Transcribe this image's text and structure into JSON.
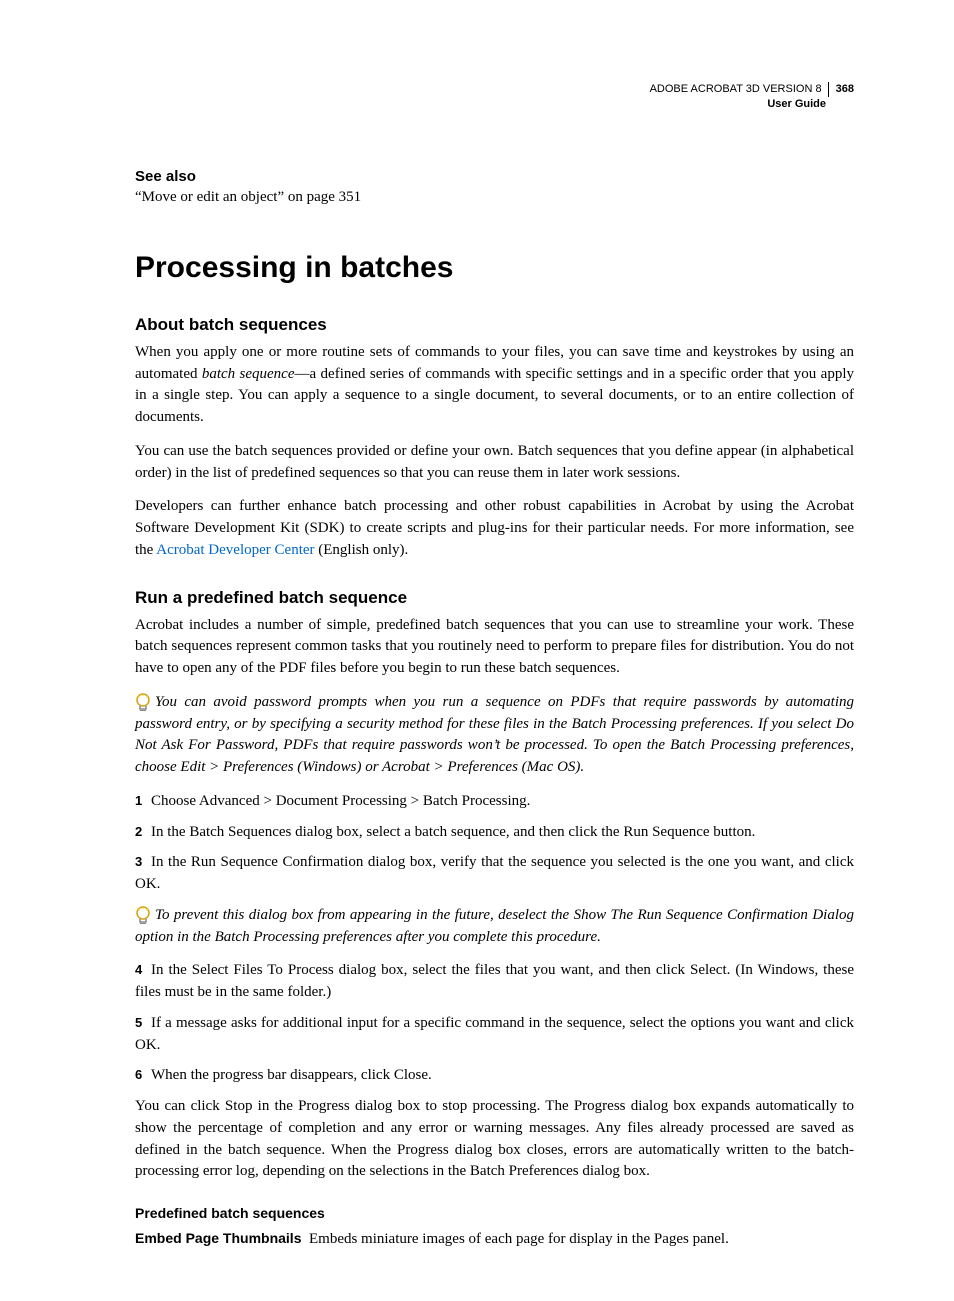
{
  "header": {
    "product": "ADOBE ACROBAT 3D VERSION 8",
    "doc": "User Guide",
    "page": "368"
  },
  "see_also": {
    "heading": "See also",
    "text": "“Move or edit an object” on page 351"
  },
  "h1": "Processing in batches",
  "section1": {
    "heading": "About batch sequences",
    "p1a": "When you apply one or more routine sets of commands to your files, you can save time and keystrokes by using an automated ",
    "p1b": "batch sequence",
    "p1c": "—a defined series of commands with specific settings and in a specific order that you apply in a single step. You can apply a sequence to a single document, to several documents, or to an entire collection of documents.",
    "p2": "You can use the batch sequences provided or define your own. Batch sequences that you define appear (in alphabetical order) in the list of predefined sequences so that you can reuse them in later work sessions.",
    "p3a": "Developers can further enhance batch processing and other robust capabilities in Acrobat by using the Acrobat Software Development Kit (SDK) to create scripts and plug-ins for their particular needs. For more information, see the ",
    "p3_link": "Acrobat Developer Center",
    "p3b": " (English only)."
  },
  "section2": {
    "heading": "Run a predefined batch sequence",
    "p1": "Acrobat includes a number of simple, predefined batch sequences that you can use to streamline your work. These batch sequences represent common tasks that you routinely need to perform to prepare files for distribution. You do not have to open any of the PDF files before you begin to run these batch sequences.",
    "tip1": "You can avoid password prompts when you run a sequence on PDFs that require passwords by automating password entry, or by specifying a security method for these files in the Batch Processing preferences. If you select Do Not Ask For Password, PDFs that require passwords won’t be processed. To open the Batch Processing preferences, choose Edit > Preferences (Windows) or Acrobat > Preferences (Mac OS).",
    "steps": {
      "n1": "1",
      "s1": "Choose Advanced > Document Processing > Batch Processing.",
      "n2": "2",
      "s2": "In the Batch Sequences dialog box, select a batch sequence, and then click the Run Sequence button.",
      "n3": "3",
      "s3": "In the Run Sequence Confirmation dialog box, verify that the sequence you selected is the one you want, and click OK.",
      "n4": "4",
      "s4": "In the Select Files To Process dialog box, select the files that you want, and then click Select. (In Windows, these files must be in the same folder.)",
      "n5": "5",
      "s5": "If a message asks for additional input for a specific command in the sequence, select the options you want and click OK.",
      "n6": "6",
      "s6": "When the progress bar disappears, click Close."
    },
    "tip2": "To prevent this dialog box from appearing in the future, deselect the Show The Run Sequence Confirmation Dialog option in the Batch Processing preferences after you complete this procedure.",
    "p2": "You can click Stop in the Progress dialog box to stop processing. The Progress dialog box expands automatically to show the percentage of completion and any error or warning messages. Any files already processed are saved as defined in the batch sequence. When the Progress dialog box closes, errors are automatically written to the batch-processing error log, depending on the selections in the Batch Preferences dialog box."
  },
  "section3": {
    "heading": "Predefined batch sequences",
    "term1": "Embed Page Thumbnails",
    "def1": "Embeds miniature images of each page for display in the Pages panel."
  }
}
